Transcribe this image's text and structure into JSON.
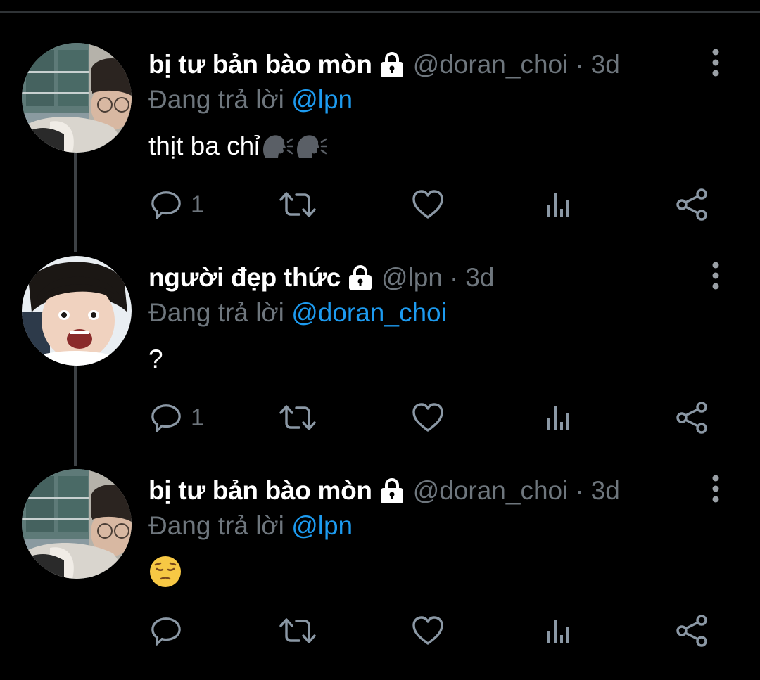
{
  "colors": {
    "background": "#000000",
    "divider": "#2f3336",
    "thread_line": "#3d4145",
    "muted": "#6e767d",
    "mention": "#1d9bf0",
    "text": "#ffffff"
  },
  "tweets": [
    {
      "display_name": "bị tư bản bào mòn",
      "handle": "@doran_choi",
      "separator": "·",
      "time": "3d",
      "replying_prefix": "Đang trả lời",
      "replying_to": "@lpn",
      "text": "thịt ba chỉ",
      "emoji": [
        "speaking-head-emoji",
        "speaking-head-emoji"
      ],
      "reply_count": "1",
      "protected_icon": "lock-icon",
      "avatar": "avatar-doran-choi"
    },
    {
      "display_name": "người đẹp thức",
      "handle": "@lpn",
      "separator": "·",
      "time": "3d",
      "replying_prefix": "Đang trả lời",
      "replying_to": "@doran_choi",
      "text": "?",
      "emoji": [],
      "reply_count": "1",
      "protected_icon": "lock-icon",
      "avatar": "avatar-lpn"
    },
    {
      "display_name": "bị tư bản bào mòn",
      "handle": "@doran_choi",
      "separator": "·",
      "time": "3d",
      "replying_prefix": "Đang trả lời",
      "replying_to": "@lpn",
      "text": "",
      "emoji": [
        "pensive-face-emoji"
      ],
      "reply_count": "",
      "protected_icon": "lock-icon",
      "avatar": "avatar-doran-choi"
    }
  ],
  "action_icons": [
    "reply-icon",
    "retweet-icon",
    "like-icon",
    "analytics-icon",
    "share-icon"
  ]
}
